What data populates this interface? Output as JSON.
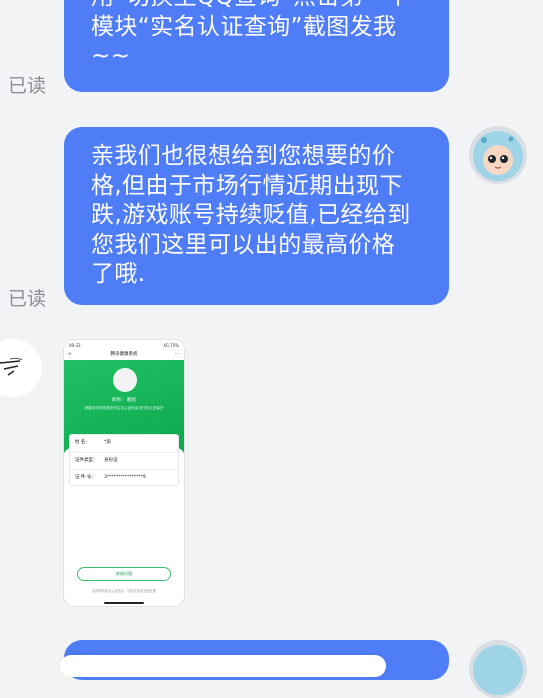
{
  "messages": [
    {
      "lines": [
        "用“切换至QQ查询”点击第一个",
        "模块“实名认证查询”截图发我",
        "~~"
      ],
      "read": "已读"
    },
    {
      "lines": [
        "亲我们也很想给到您想要的价",
        "格,但由于市场行情近期出现下",
        "跌,游戏账号持续贬值,已经给到",
        "您我们这里可以出的最高价格",
        "了哦."
      ],
      "read": "已读"
    }
  ],
  "screenshot": {
    "time": "09:33",
    "status_right": "4G 75%",
    "nav_back": "<",
    "nav_title": "腾讯健康系统",
    "nav_more": "···",
    "nickname": "昵称： 鹏程",
    "tip": "健康系统将根据您的实名认证信息进行防沉迷保护",
    "rows": [
      {
        "key": "姓    名：",
        "value": "*渝"
      },
      {
        "key": "证件类型：",
        "value": "身份证"
      },
      {
        "key": "证 件 号：",
        "value": "3****************9"
      }
    ],
    "button": "修改问题",
    "footer": "如需修改实名认证信息，请前往相关页面处理"
  },
  "colors": {
    "self_bubble": "#4f7cf7",
    "background": "#f2f3f5",
    "read_text": "#8a8d93",
    "green": "#1bb85c"
  },
  "icons": [
    "avatar-cartoon-blue",
    "avatar-sketch"
  ]
}
